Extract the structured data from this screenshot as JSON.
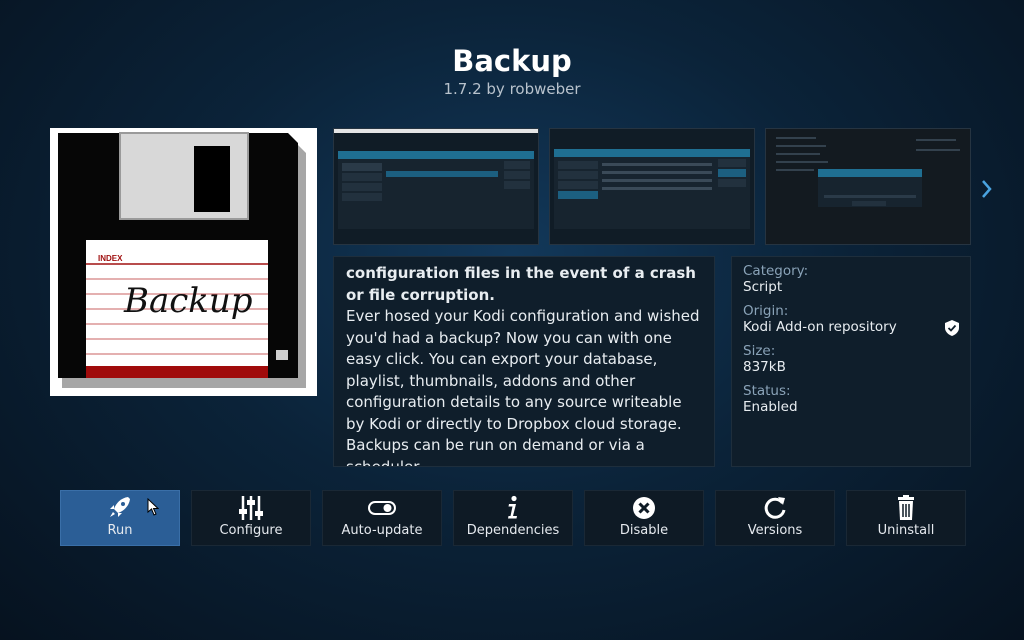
{
  "addon": {
    "title": "Backup",
    "subtitle": "1.7.2 by robweber"
  },
  "icon": {
    "index_label": "INDEX",
    "handwritten": "Backup"
  },
  "description": {
    "bold_lines": "configuration files in the event of a crash or file corruption.",
    "body": "Ever hosed your Kodi configuration and wished you'd had a backup? Now you can with one easy click. You can export your database, playlist, thumbnails, addons and other configuration details to any source writeable by Kodi or directly to Dropbox cloud storage. Backups can be run on demand or via a scheduler."
  },
  "info": {
    "category_label": "Category:",
    "category": "Script",
    "origin_label": "Origin:",
    "origin": "Kodi Add-on repository",
    "size_label": "Size:",
    "size": "837kB",
    "status_label": "Status:",
    "status": "Enabled"
  },
  "buttons": [
    {
      "label": "Run",
      "icon": "rocket-icon"
    },
    {
      "label": "Configure",
      "icon": "sliders-icon"
    },
    {
      "label": "Auto-update",
      "icon": "toggle-icon"
    },
    {
      "label": "Dependencies",
      "icon": "info-icon"
    },
    {
      "label": "Disable",
      "icon": "close-circle-icon"
    },
    {
      "label": "Versions",
      "icon": "refresh-icon"
    },
    {
      "label": "Uninstall",
      "icon": "trash-icon"
    }
  ],
  "colors": {
    "accent": "#2b5e96",
    "panel": "#0f1e2b",
    "label": "#8aa3b8"
  }
}
